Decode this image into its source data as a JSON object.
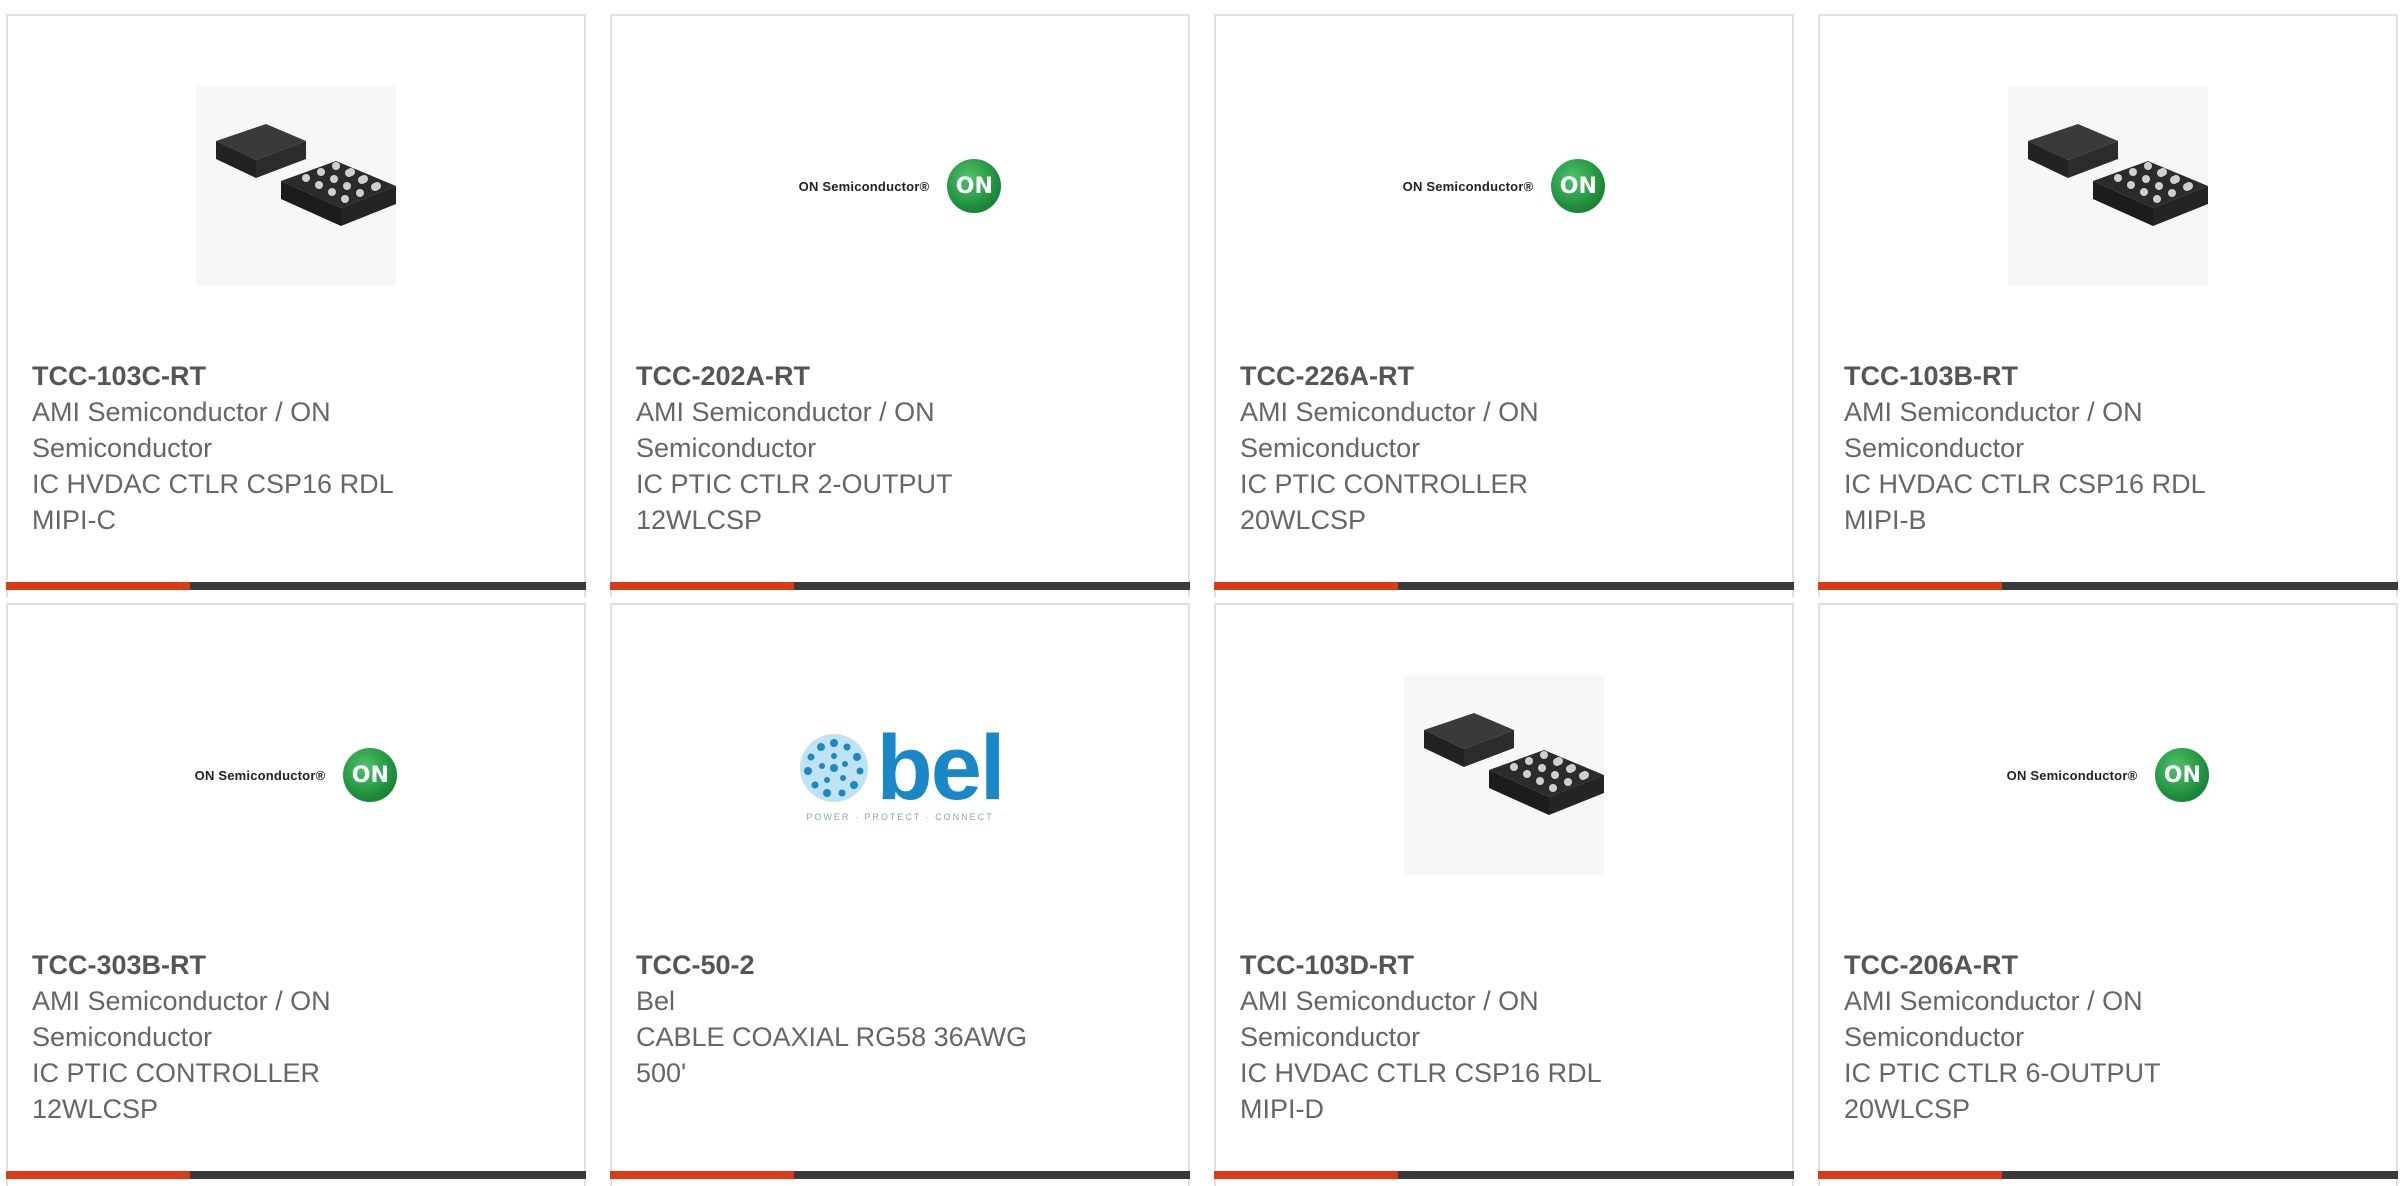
{
  "products": [
    {
      "part_number": "TCC-103C-RT",
      "manufacturer": "AMI Semiconductor / ON Semiconductor",
      "description": "IC HVDAC CTLR CSP16 RDL\nMIPI-C",
      "image": "chip-package"
    },
    {
      "part_number": "TCC-202A-RT",
      "manufacturer": "AMI Semiconductor / ON Semiconductor",
      "description": "IC PTIC CTLR 2-OUTPUT\n12WLCSP",
      "image": "on-semiconductor-logo"
    },
    {
      "part_number": "TCC-226A-RT",
      "manufacturer": "AMI Semiconductor / ON Semiconductor",
      "description": "IC PTIC CONTROLLER\n20WLCSP",
      "image": "on-semiconductor-logo"
    },
    {
      "part_number": "TCC-103B-RT",
      "manufacturer": "AMI Semiconductor / ON Semiconductor",
      "description": "IC HVDAC CTLR CSP16 RDL\nMIPI-B",
      "image": "chip-package"
    },
    {
      "part_number": "TCC-303B-RT",
      "manufacturer": "AMI Semiconductor / ON Semiconductor",
      "description": "IC PTIC CONTROLLER\n12WLCSP",
      "image": "on-semiconductor-logo"
    },
    {
      "part_number": "TCC-50-2",
      "manufacturer": "Bel",
      "description": "CABLE COAXIAL RG58 36AWG\n500'",
      "image": "bel-logo"
    },
    {
      "part_number": "TCC-103D-RT",
      "manufacturer": "AMI Semiconductor / ON Semiconductor",
      "description": "IC HVDAC CTLR CSP16 RDL\nMIPI-D",
      "image": "chip-package"
    },
    {
      "part_number": "TCC-206A-RT",
      "manufacturer": "AMI Semiconductor / ON Semiconductor",
      "description": "IC PTIC CTLR 6-OUTPUT\n20WLCSP",
      "image": "on-semiconductor-logo"
    }
  ],
  "logos": {
    "on_text": "ON Semiconductor®",
    "on_badge": "ON",
    "bel_word": "bel",
    "bel_tagline": "POWER · PROTECT · CONNECT"
  },
  "colors": {
    "accent": "#d83b16",
    "bar": "#3a3a3a",
    "border": "#e0e0e0",
    "text": "#666666",
    "bel_blue": "#1a87c9",
    "on_green": "#1f8f3c"
  }
}
